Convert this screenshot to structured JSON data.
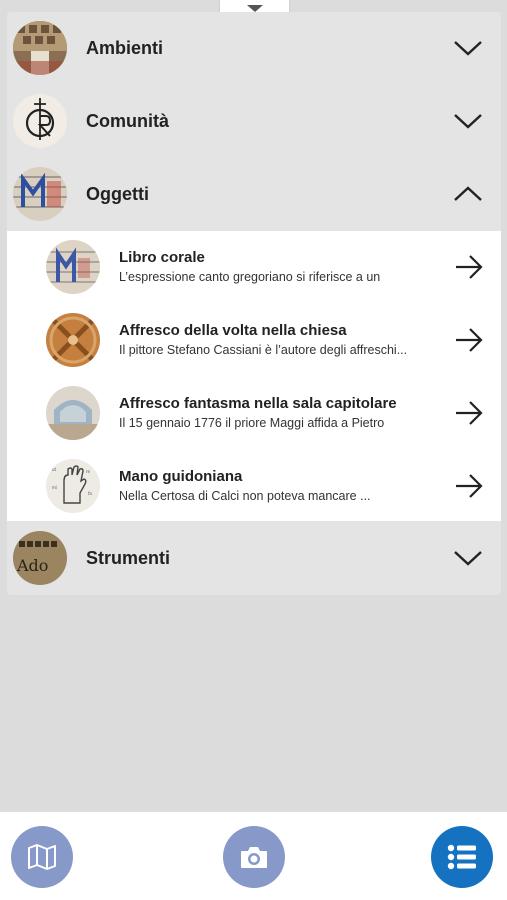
{
  "categories": [
    {
      "label": "Ambienti",
      "expanded": false
    },
    {
      "label": "Comunità",
      "expanded": false
    },
    {
      "label": "Oggetti",
      "expanded": true
    },
    {
      "label": "Strumenti",
      "expanded": false
    }
  ],
  "oggetti_items": [
    {
      "title": "Libro corale",
      "desc": "L’espressione canto gregoriano si riferisce a un"
    },
    {
      "title": "Affresco della volta nella chiesa",
      "desc": "Il pittore Stefano Cassiani è l’autore degli affreschi..."
    },
    {
      "title": "Affresco fantasma nella sala capitolare",
      "desc": "Il 15 gennaio 1776 il priore Maggi affida a Pietro"
    },
    {
      "title": "Mano guidoniana",
      "desc": "Nella Certosa di Calci non poteva mancare ..."
    }
  ],
  "bottom_nav": {
    "map_icon": "map-icon",
    "camera_icon": "camera-icon",
    "list_icon": "list-icon",
    "accent": "#1572c0",
    "inactive": "#8799c9"
  }
}
